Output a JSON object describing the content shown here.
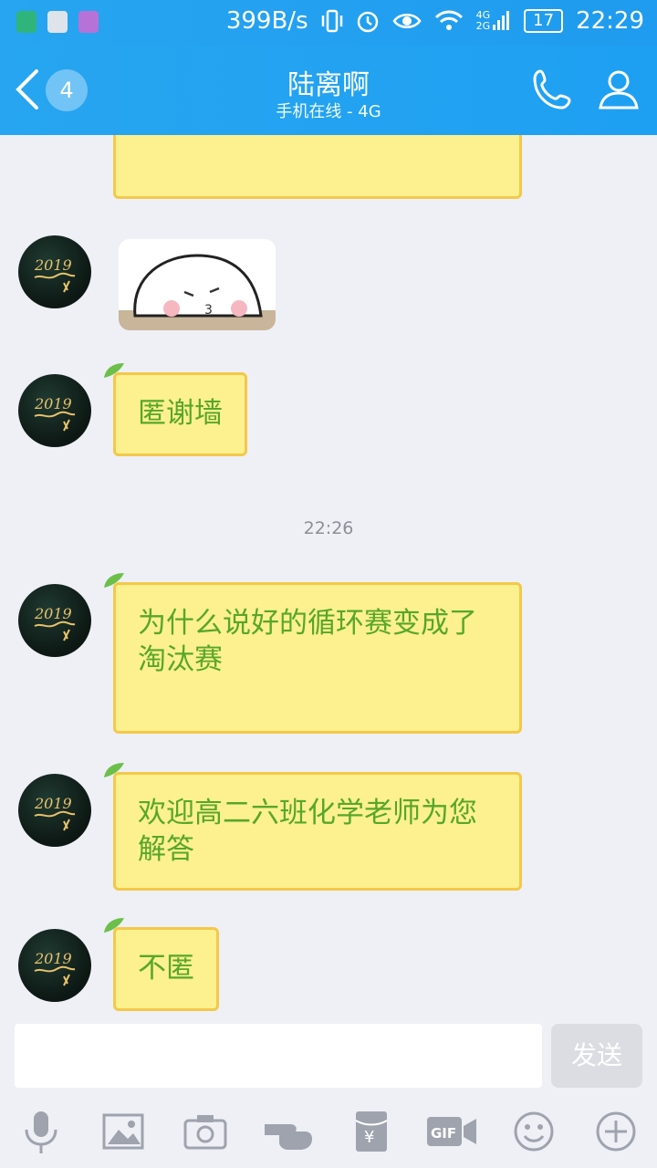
{
  "status_bar": {
    "net_speed": "399B/s",
    "signal_labels": [
      "4G",
      "2G"
    ],
    "battery": "17",
    "time": "22:29"
  },
  "header": {
    "unread_count": "4",
    "contact_name": "陆离啊",
    "contact_status": "手机在线 - 4G"
  },
  "messages": [
    {
      "type": "text",
      "text": "匿谢墙"
    },
    {
      "type": "timestamp",
      "text": "22:26"
    },
    {
      "type": "text",
      "text": "为什么说好的循环赛变成了淘汰赛"
    },
    {
      "type": "text",
      "text": "欢迎高二六班化学老师为您解答"
    },
    {
      "type": "text",
      "text": "不匿"
    }
  ],
  "input": {
    "placeholder": "",
    "value": ""
  },
  "send_button": {
    "label": "发送"
  },
  "toolbar": [
    "mic-icon",
    "image-icon",
    "camera-icon",
    "poke-icon",
    "red-packet-icon",
    "gif-icon",
    "emoji-icon",
    "plus-icon"
  ],
  "colors": {
    "header": "#1ea0f2",
    "bubble_fill": "#fdf08e",
    "bubble_border": "#f3c84a",
    "bubble_text": "#57a72a"
  }
}
